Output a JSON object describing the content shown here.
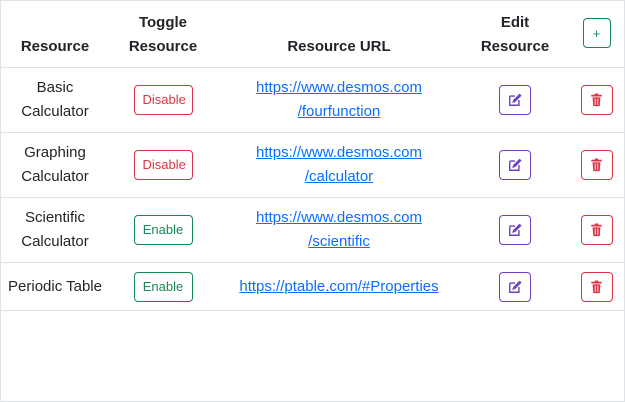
{
  "colors": {
    "danger": "#dc3545",
    "success": "#198754",
    "purple": "#6f42c1",
    "link": "#0d6efd",
    "border": "#dee2e6"
  },
  "header": {
    "resource": "Resource",
    "toggle_line1": "Toggle",
    "toggle_line2": "Resource",
    "url": "Resource URL",
    "edit_line1": "Edit",
    "edit_line2": "Resource",
    "add_label": "+"
  },
  "rows": [
    {
      "name_line1": "Basic",
      "name_line2": "Calculator",
      "toggle_label": "Disable",
      "toggle_state": "disable",
      "url_line1": "https://www.desmos.com",
      "url_line2": "/fourfunction",
      "edit_icon": "edit-icon",
      "delete_icon": "trash-icon"
    },
    {
      "name_line1": "Graphing",
      "name_line2": "Calculator",
      "toggle_label": "Disable",
      "toggle_state": "disable",
      "url_line1": "https://www.desmos.com",
      "url_line2": "/calculator",
      "edit_icon": "edit-icon",
      "delete_icon": "trash-icon"
    },
    {
      "name_line1": "Scientific",
      "name_line2": "Calculator",
      "toggle_label": "Enable",
      "toggle_state": "enable",
      "url_line1": "https://www.desmos.com",
      "url_line2": "/scientific",
      "edit_icon": "edit-icon",
      "delete_icon": "trash-icon"
    },
    {
      "name_line1": "Periodic Table",
      "name_line2": "",
      "toggle_label": "Enable",
      "toggle_state": "enable",
      "url_line1": "https://ptable.com/#Properties",
      "url_line2": "",
      "edit_icon": "edit-icon",
      "delete_icon": "trash-icon"
    }
  ]
}
